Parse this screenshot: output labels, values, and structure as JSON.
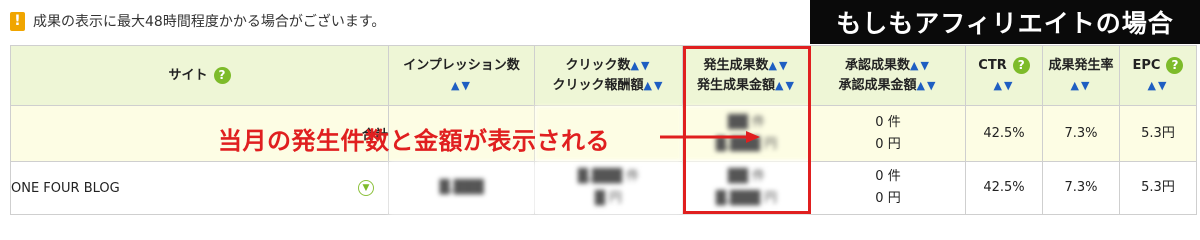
{
  "notice": {
    "icon": "warning-icon",
    "text": "成果の表示に最大48時間程度かかる場合がございます。"
  },
  "banner": "もしもアフィリエイトの場合",
  "sort_arrows": "▲▼",
  "help_glyph": "?",
  "headers": {
    "site": "サイト",
    "impressions": "インプレッション数",
    "clicks": "クリック数",
    "click_reward": "クリック報酬額",
    "generated_count": "発生成果数",
    "generated_amount": "発生成果金額",
    "approved_count": "承認成果数",
    "approved_amount": "承認成果金額",
    "ctr": "CTR",
    "gen_rate": "成果発生率",
    "epc": "EPC"
  },
  "rows": {
    "total": {
      "label": "合計",
      "approved_count": "0 件",
      "approved_amount": "0 円",
      "ctr": "42.5%",
      "gen_rate": "7.3%",
      "epc": "5.3円"
    },
    "site": {
      "label": "ONE FOUR BLOG",
      "approved_count": "0 件",
      "approved_amount": "0 円",
      "ctr": "42.5%",
      "gen_rate": "7.3%",
      "epc": "5.3円"
    }
  },
  "annotation": "当月の発生件数と金額が表示される",
  "colors": {
    "header_bg": "#eef6d6",
    "total_bg": "#fdfde4",
    "accent_red": "#e01f1f",
    "sort_blue": "#1e5ec2",
    "help_green": "#7dbb2a"
  }
}
